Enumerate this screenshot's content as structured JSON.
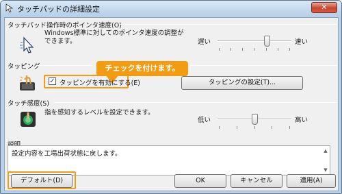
{
  "window": {
    "title": "タッチパッドの詳細設定",
    "close_label": "✕"
  },
  "speed": {
    "header": "タッチパッド操作時のポインタ速度(O)",
    "description": "Windows標準に対してのポインタ速度の調整ができます。",
    "slow_label": "遅い",
    "fast_label": "速い",
    "level": 0.67
  },
  "tapping": {
    "header": "タッピング",
    "checkbox_label": "タッピングを有効にする(E)",
    "checked": true,
    "settings_button": "タッピングの設定(T)..."
  },
  "sensitivity": {
    "header": "タッチ感度(S)",
    "description": "指を感知するレベルを設定できます。",
    "low_label": "低い",
    "high_label": "高い",
    "level": 0.5
  },
  "explanation": {
    "header": "説明",
    "text": "設定内容を工場出荷状態に戻します。"
  },
  "callout": {
    "text": "チェックを付けます。"
  },
  "buttons": {
    "default": "デフォルト(D)",
    "ok": "OK",
    "cancel": "キャンセル",
    "apply": "適用(A)"
  },
  "colors": {
    "accent": "#f39c12"
  }
}
